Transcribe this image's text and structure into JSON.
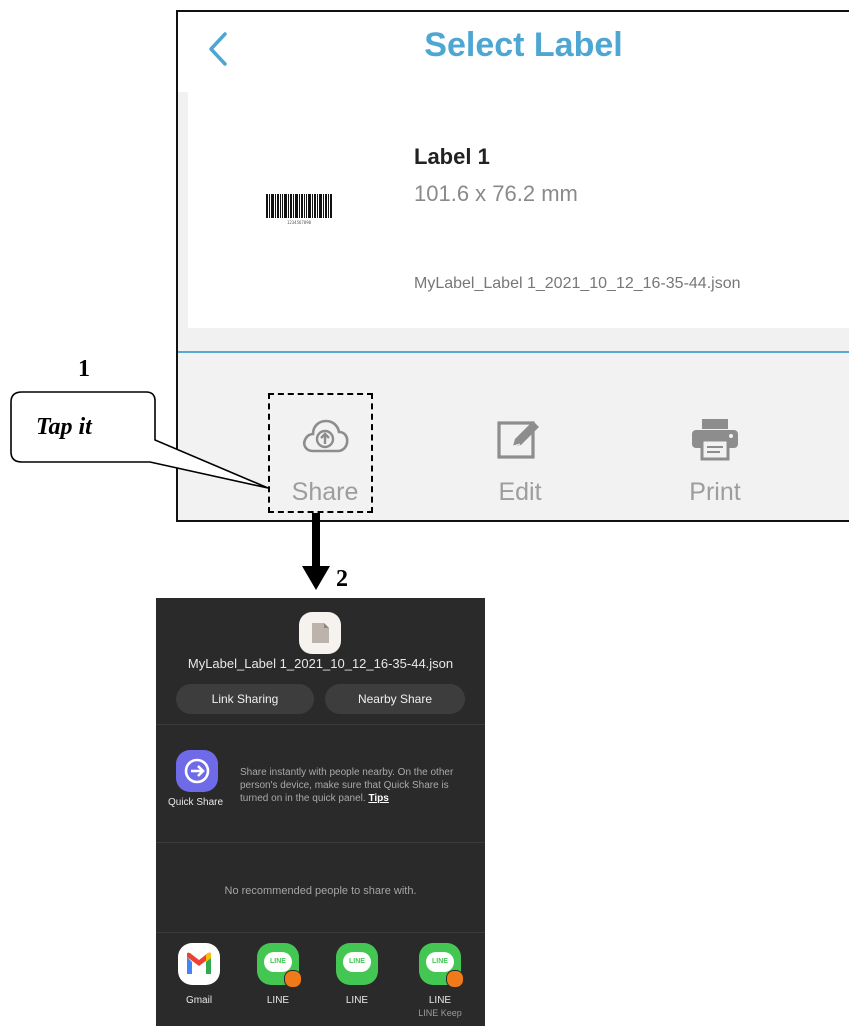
{
  "app": {
    "title": "Select Label",
    "back_icon": "chevron-left-icon"
  },
  "label": {
    "name": "Label 1",
    "size": "101.6 x 76.2 mm",
    "file": "MyLabel_Label 1_2021_10_12_16-35-44.json",
    "barcode_caption": "1234567890"
  },
  "actions": {
    "share": "Share",
    "edit": "Edit",
    "print": "Print"
  },
  "annotations": {
    "step1": "1",
    "step2": "2",
    "callout": "Tap it"
  },
  "share_sheet": {
    "filename": "MyLabel_Label 1_2021_10_12_16-35-44.json",
    "link_sharing": "Link Sharing",
    "nearby_share": "Nearby Share",
    "quick_share_label": "Quick Share",
    "quick_share_desc": "Share instantly with people nearby. On the other person's device, make sure that Quick Share is turned on in the quick panel.",
    "tips": "Tips",
    "no_recommended": "No recommended people to share with.",
    "apps": [
      {
        "name": "Gmail",
        "sub": ""
      },
      {
        "name": "LINE",
        "sub": ""
      },
      {
        "name": "LINE",
        "sub": ""
      },
      {
        "name": "LINE",
        "sub": "LINE Keep"
      }
    ],
    "line_icon_text": "LINE"
  },
  "colors": {
    "accent": "#4da7d2",
    "divider": "#57a9d0",
    "sheet_bg": "#2a2a2a",
    "quick_share": "#6f6ae8",
    "line_green": "#44c653"
  }
}
